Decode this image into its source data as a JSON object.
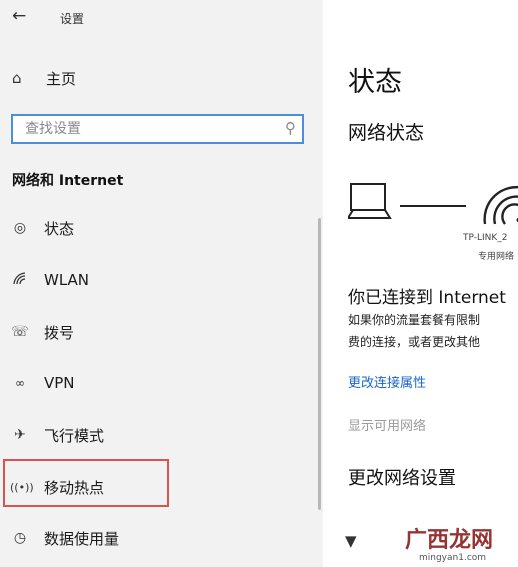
{
  "window": {
    "title": "设置"
  },
  "sidebar": {
    "home_label": "主页",
    "search_placeholder": "查找设置",
    "section_header": "网络和 Internet",
    "items": [
      {
        "label": "状态",
        "icon": "globe-icon"
      },
      {
        "label": "WLAN",
        "icon": "wifi-icon"
      },
      {
        "label": "拨号",
        "icon": "phone-icon"
      },
      {
        "label": "VPN",
        "icon": "vpn-icon"
      },
      {
        "label": "飞行模式",
        "icon": "airplane-icon"
      },
      {
        "label": "移动热点",
        "icon": "hotspot-icon"
      },
      {
        "label": "数据使用量",
        "icon": "data-usage-icon"
      }
    ],
    "highlighted_item": "移动热点"
  },
  "main": {
    "title": "状态",
    "subtitle": "网络状态",
    "ssid": "TP-LINK_2",
    "network_type": "专用网络",
    "connected": "你已连接到 Internet",
    "desc_line1": "如果你的流量套餐有限制",
    "desc_line2": "费的连接，或者更改其他",
    "link_properties": "更改连接属性",
    "link_available": "显示可用网络",
    "change_settings": "更改网络设置"
  },
  "watermark": {
    "text": "广西龙网",
    "url": "mingyan1.com"
  },
  "colors": {
    "accent": "#1a66c8",
    "highlight_border": "#d9534f",
    "sidebar_bg": "#f2f2f2"
  }
}
